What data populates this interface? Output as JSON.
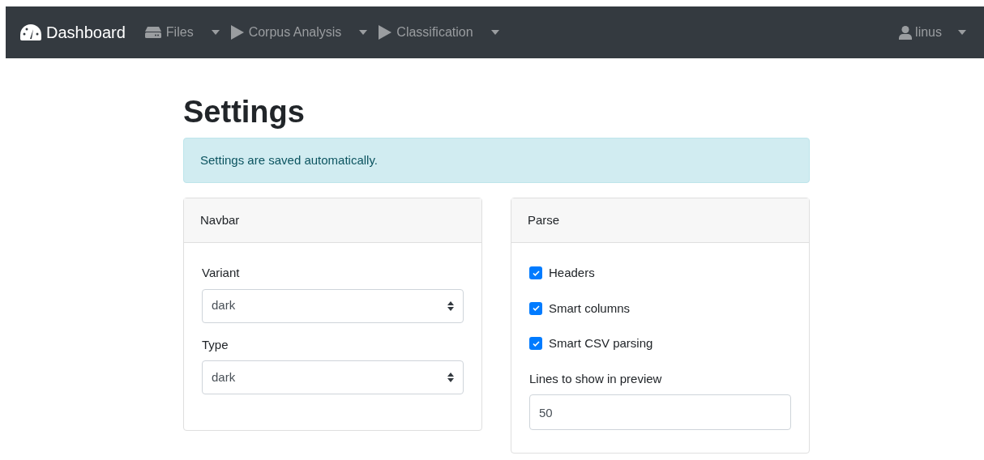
{
  "navbar": {
    "brand": "Dashboard",
    "menus": [
      {
        "kind": "drive",
        "label": "Files"
      },
      {
        "kind": "play",
        "label": "Corpus Analysis"
      },
      {
        "kind": "play",
        "label": "Classification"
      }
    ],
    "user": "linus"
  },
  "title": "Settings",
  "alert": "Settings are saved automatically.",
  "cards": [
    {
      "title": "Navbar",
      "fields": [
        {
          "kind": "select",
          "label": "Variant",
          "value": "dark"
        },
        {
          "kind": "select",
          "label": "Type",
          "value": "dark"
        }
      ]
    },
    {
      "title": "Parse",
      "fields": [
        {
          "kind": "checkbox",
          "label": "Headers",
          "checked": true
        },
        {
          "kind": "checkbox",
          "label": "Smart columns",
          "checked": true
        },
        {
          "kind": "checkbox",
          "label": "Smart CSV parsing",
          "checked": true
        },
        {
          "kind": "input",
          "label": "Lines to show in preview",
          "value": "50"
        }
      ]
    }
  ]
}
